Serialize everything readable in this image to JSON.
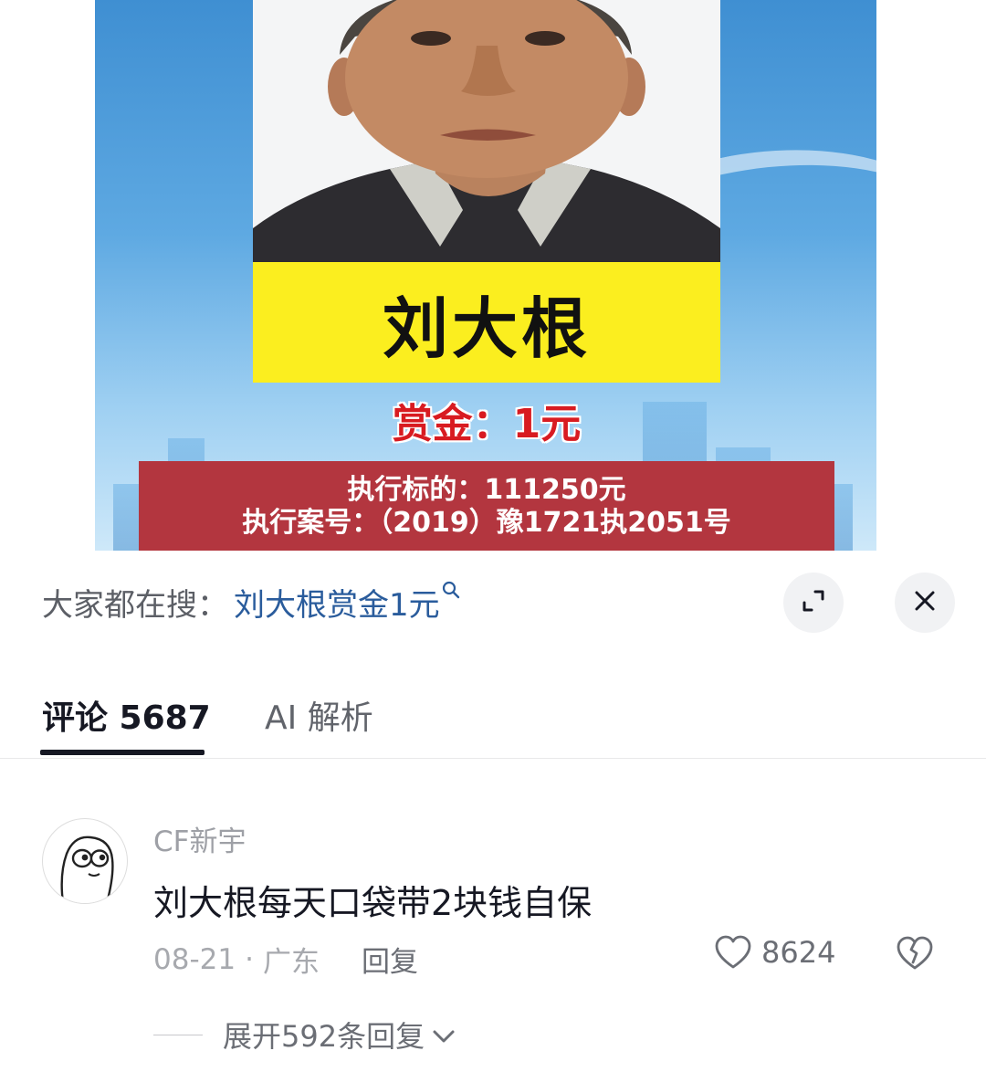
{
  "video": {
    "name_plate": "刘大根",
    "reward_text": "赏金：1元",
    "execution_target": "执行标的：111250元",
    "case_number": "执行案号：（2019）豫1721执2051号"
  },
  "sheet": {
    "search_prefix": "大家都在搜：",
    "search_term": "刘大根赏金1元",
    "search_term_icon": "search-icon",
    "expand_icon": "expand-icon",
    "close_icon": "close-icon"
  },
  "tabs": [
    {
      "label": "评论 5687",
      "active": true
    },
    {
      "label": "AI 解析",
      "active": false
    }
  ],
  "comment": {
    "username": "CF新宇",
    "text": "刘大根每天口袋带2块钱自保",
    "date": "08-21",
    "separator": "·",
    "location": "广东",
    "reply_label": "回复",
    "like_count": "8624",
    "expand_replies_label": "展开592条回复"
  },
  "colors": {
    "link_blue": "#2a5c9c",
    "name_plate_yellow": "#fbee1f",
    "reward_red": "#d81b21",
    "info_box_red": "#b3363f",
    "text_primary": "#161823",
    "text_secondary": "#a7a9ae"
  }
}
